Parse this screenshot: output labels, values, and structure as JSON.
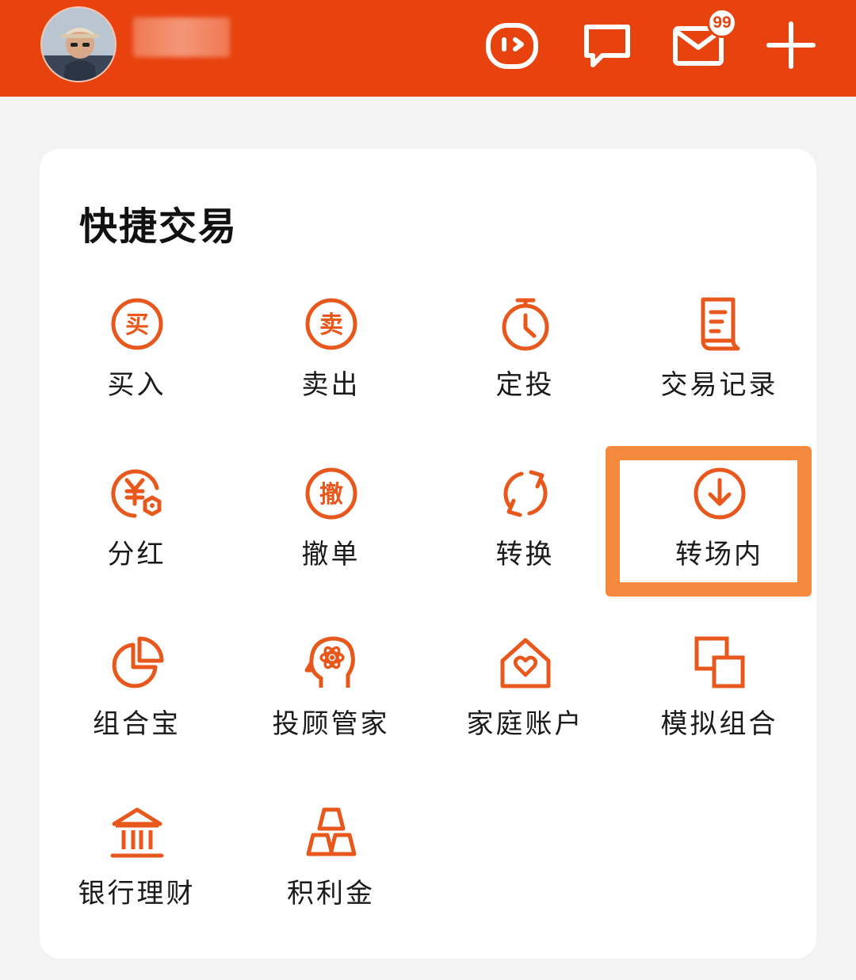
{
  "header": {
    "badge_count": "99",
    "icons": [
      "app-logo-icon",
      "chat-bubble-icon",
      "mail-icon",
      "plus-icon"
    ],
    "background": "#e8430f"
  },
  "section": {
    "title": "快捷交易"
  },
  "items": [
    {
      "label": "买入",
      "icon": "buy-icon",
      "glyph": "买"
    },
    {
      "label": "卖出",
      "icon": "sell-icon",
      "glyph": "卖"
    },
    {
      "label": "定投",
      "icon": "timer-icon"
    },
    {
      "label": "交易记录",
      "icon": "document-icon"
    },
    {
      "label": "分红",
      "icon": "dividend-icon"
    },
    {
      "label": "撤单",
      "icon": "cancel-order-icon",
      "glyph": "撤"
    },
    {
      "label": "转换",
      "icon": "convert-icon"
    },
    {
      "label": "转场内",
      "icon": "download-circle-icon"
    },
    {
      "label": "组合宝",
      "icon": "pie-chart-icon"
    },
    {
      "label": "投顾管家",
      "icon": "advisor-head-icon"
    },
    {
      "label": "家庭账户",
      "icon": "house-heart-icon"
    },
    {
      "label": "模拟组合",
      "icon": "overlap-squares-icon"
    },
    {
      "label": "银行理财",
      "icon": "bank-icon"
    },
    {
      "label": "积利金",
      "icon": "gold-bars-icon"
    }
  ],
  "accent_color": "#e8581c",
  "highlight_color": "#f58a3e"
}
